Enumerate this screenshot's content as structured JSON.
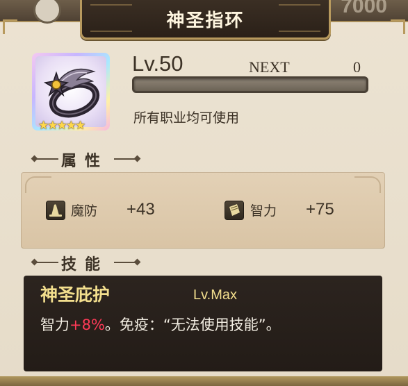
{
  "window": {
    "title": "神圣指环",
    "faded_top_number": "7000"
  },
  "item": {
    "rarity_stars": "★★★★★",
    "level": "Lv.50",
    "next_label": "NEXT",
    "next_value": "0",
    "xp_progress": 0,
    "usable_by": "所有职业均可使用"
  },
  "attributes": {
    "header": "属性",
    "stats": [
      {
        "icon": "wizard-hat-icon",
        "label": "魔防",
        "value": "+43"
      },
      {
        "icon": "scroll-icon",
        "label": "智力",
        "value": "+75"
      }
    ]
  },
  "skill": {
    "header": "技能",
    "name": "神圣庇护",
    "level": "Lv.Max",
    "desc_prefix": "智力",
    "desc_highlight": "+8%",
    "desc_suffix": "。免疫：“无法使用技能”。",
    "highlight_color": "#ff3a57"
  }
}
